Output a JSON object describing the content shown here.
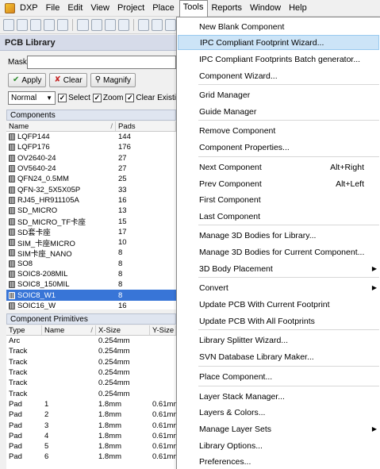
{
  "menubar": {
    "items": [
      "DXP",
      "File",
      "Edit",
      "View",
      "Project",
      "Place",
      "Tools",
      "Reports",
      "Window",
      "Help"
    ]
  },
  "panel": {
    "title": "PCB Library",
    "mask_label": "Mask",
    "mask_value": "",
    "apply_label": "Apply",
    "clear_label": "Clear",
    "magnify_label": "Magnify",
    "filter_select": "Normal",
    "select_label": "Select",
    "zoom_label": "Zoom",
    "clear_existing_label": "Clear Existi"
  },
  "components": {
    "header": "Components",
    "col_name": "Name",
    "col_pads": "Pads",
    "rows": [
      {
        "name": "LQFP144",
        "pads": "144"
      },
      {
        "name": "LQFP176",
        "pads": "176"
      },
      {
        "name": "OV2640-24",
        "pads": "27"
      },
      {
        "name": "OV5640-24",
        "pads": "27"
      },
      {
        "name": "QFN24_0.5MM",
        "pads": "25"
      },
      {
        "name": "QFN-32_5X5X05P",
        "pads": "33"
      },
      {
        "name": "RJ45_HR911105A",
        "pads": "16"
      },
      {
        "name": "SD_MICRO",
        "pads": "13"
      },
      {
        "name": "SD_MICRO_TF卡座",
        "pads": "15"
      },
      {
        "name": "SD套卡座",
        "pads": "17"
      },
      {
        "name": "SIM_卡座MICRO",
        "pads": "10"
      },
      {
        "name": "SIM卡座_NANO",
        "pads": "8"
      },
      {
        "name": "SO8",
        "pads": "8"
      },
      {
        "name": "SOIC8-208MIL",
        "pads": "8"
      },
      {
        "name": "SOIC8_150MIL",
        "pads": "8"
      },
      {
        "name": "SOIC8_W1",
        "pads": "8",
        "selected": true
      },
      {
        "name": "SOIC16_W",
        "pads": "16"
      }
    ]
  },
  "primitives": {
    "header": "Component Primitives",
    "cols": [
      "Type",
      "Name",
      "X-Size",
      "Y-Size"
    ],
    "rows": [
      {
        "type": "Arc",
        "name": "",
        "x": "0.254mm",
        "y": ""
      },
      {
        "type": "Track",
        "name": "",
        "x": "0.254mm",
        "y": ""
      },
      {
        "type": "Track",
        "name": "",
        "x": "0.254mm",
        "y": ""
      },
      {
        "type": "Track",
        "name": "",
        "x": "0.254mm",
        "y": ""
      },
      {
        "type": "Track",
        "name": "",
        "x": "0.254mm",
        "y": ""
      },
      {
        "type": "Track",
        "name": "",
        "x": "0.254mm",
        "y": ""
      },
      {
        "type": "Pad",
        "name": "1",
        "x": "1.8mm",
        "y": "0.61mm"
      },
      {
        "type": "Pad",
        "name": "2",
        "x": "1.8mm",
        "y": "0.61mm"
      },
      {
        "type": "Pad",
        "name": "3",
        "x": "1.8mm",
        "y": "0.61mm"
      },
      {
        "type": "Pad",
        "name": "4",
        "x": "1.8mm",
        "y": "0.61mm"
      },
      {
        "type": "Pad",
        "name": "5",
        "x": "1.8mm",
        "y": "0.61mm"
      },
      {
        "type": "Pad",
        "name": "6",
        "x": "1.8mm",
        "y": "0.61mm"
      }
    ]
  },
  "tools_menu": {
    "items": [
      {
        "label": "New Blank Component"
      },
      {
        "label": "IPC Compliant Footprint Wizard...",
        "highlighted": true
      },
      {
        "label": "IPC Compliant Footprints Batch generator..."
      },
      {
        "label": "Component Wizard..."
      },
      {
        "label": "Grid Manager"
      },
      {
        "label": "Guide Manager"
      },
      {
        "label": "Remove Component"
      },
      {
        "label": "Component Properties..."
      },
      {
        "label": "Next Component",
        "shortcut": "Alt+Right"
      },
      {
        "label": "Prev Component",
        "shortcut": "Alt+Left"
      },
      {
        "label": "First Component"
      },
      {
        "label": "Last Component"
      },
      {
        "label": "Manage 3D Bodies for Library..."
      },
      {
        "label": "Manage 3D Bodies for Current Component..."
      },
      {
        "label": "3D Body Placement",
        "submenu": true
      },
      {
        "label": "Convert",
        "submenu": true
      },
      {
        "label": "Update PCB With Current Footprint"
      },
      {
        "label": "Update PCB With All Footprints"
      },
      {
        "label": "Library Splitter Wizard..."
      },
      {
        "label": "SVN Database Library Maker..."
      },
      {
        "label": "Place Component..."
      },
      {
        "label": "Layer Stack Manager..."
      },
      {
        "label": "Layers & Colors..."
      },
      {
        "label": "Manage Layer Sets",
        "submenu": true
      },
      {
        "label": "Library Options..."
      },
      {
        "label": "Preferences..."
      }
    ]
  }
}
